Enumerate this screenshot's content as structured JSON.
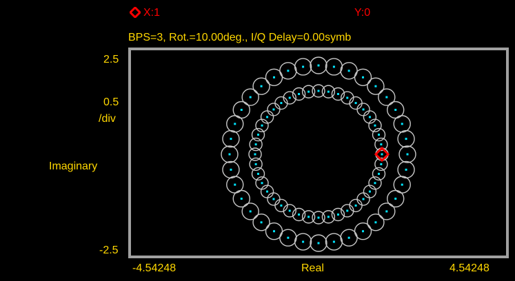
{
  "marker": {
    "x_readout": "X:1",
    "y_readout": "Y:0",
    "icon": "red-diamond-marker-icon"
  },
  "header": {
    "info": "BPS=3, Rot.=10.00deg., I/Q Delay=0.00symb"
  },
  "y_axis": {
    "top": "2.5",
    "scale": "0.5",
    "scale_unit": "/div",
    "label": "Imaginary",
    "bottom": "-2.5"
  },
  "x_axis": {
    "left": "-4.54248",
    "label": "Real",
    "right": "4.54248"
  },
  "colors": {
    "label": "#ffd700",
    "marker": "#ff0000",
    "ring": "#c8c8c8",
    "point": "#00e5ff",
    "frame": "#a0a0a0",
    "background": "#000000"
  },
  "constellation": {
    "outer_ring_points": 36,
    "inner_ring_points": 40,
    "marker_ring": "inner",
    "marker_angle_deg": 0
  }
}
